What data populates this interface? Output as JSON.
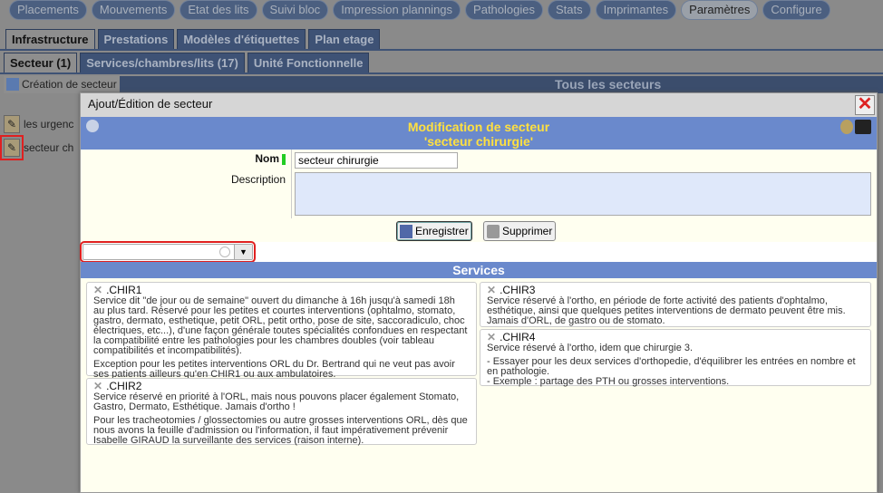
{
  "nav": [
    "Placements",
    "Mouvements",
    "Etat des lits",
    "Suivi bloc",
    "Impression plannings",
    "Pathologies",
    "Stats",
    "Imprimantes",
    "Paramètres",
    "Configure"
  ],
  "nav_active": "Paramètres",
  "tabs": [
    "Infrastructure",
    "Prestations",
    "Modèles d'étiquettes",
    "Plan etage"
  ],
  "subtabs": [
    "Secteur (1)",
    "Services/chambres/lits (17)",
    "Unité Fonctionnelle"
  ],
  "create_button": "Création de secteur",
  "list_title": "Tous les secteurs",
  "rows": [
    "les urgenc",
    "secteur ch"
  ],
  "modal": {
    "title": "Ajout/Édition de secteur",
    "heading": "Modification de secteur",
    "subheading": "'secteur chirurgie'",
    "name_label": "Nom",
    "name_value": "secteur chirurgie",
    "description_label": "Description",
    "description_value": "",
    "save": "Enregistrer",
    "delete": "Supprimer",
    "combo_value": "",
    "services_title": "Services"
  },
  "services": [
    {
      "name": ".CHIR1",
      "paragraphs": [
        "Service dit \"de jour ou de semaine\" ouvert du dimanche à 16h jusqu'à samedi 18h au plus tard. Réservé pour les petites et courtes interventions (ophtalmo, stomato, gastro, dermato, esthetique, petit ORL, petit ortho, pose de site, saccoradiculo, choc électriques, etc...), d'une façon générale toutes spécialités confondues en respectant la compatibilité entre les pathologies pour les chambres doubles (voir tableau compatibilités et incompatibilités).",
        "Exception pour les petites interventions ORL du Dr. Bertrand qui ne veut pas avoir ses patients ailleurs qu'en CHIR1 ou aux ambulatoires."
      ]
    },
    {
      "name": ".CHIR2",
      "paragraphs": [
        "Service réservé en priorité à l'ORL, mais nous pouvons placer également Stomato, Gastro, Dermato, Esthétique. Jamais d'ortho !",
        "Pour les tracheotomies / glossectomies ou autre grosses interventions ORL, dès que nous avons la feuille d'admission ou l'information, il faut impérativement prévenir Isabelle GIRAUD la surveillante des services (raison interne)."
      ]
    },
    {
      "name": ".CHIR3",
      "paragraphs": [
        "Service réservé à l'ortho, en période de forte activité des patients d'ophtalmo, esthétique, ainsi que quelques petites interventions de dermato peuvent être mis. Jamais d'ORL, de gastro ou de stomato."
      ]
    },
    {
      "name": ".CHIR4",
      "paragraphs": [
        "Service réservé à l'ortho, idem que chirurgie 3.",
        "- Essayer pour les deux services d'orthopedie, d'équilibrer les entrées en nombre et en pathologie.\n- Exemple : partage des PTH ou grosses interventions."
      ]
    }
  ],
  "colors": {
    "header_blue": "#6a89cc",
    "heading_yellow": "#ffe040",
    "highlight_red": "#e02020"
  }
}
